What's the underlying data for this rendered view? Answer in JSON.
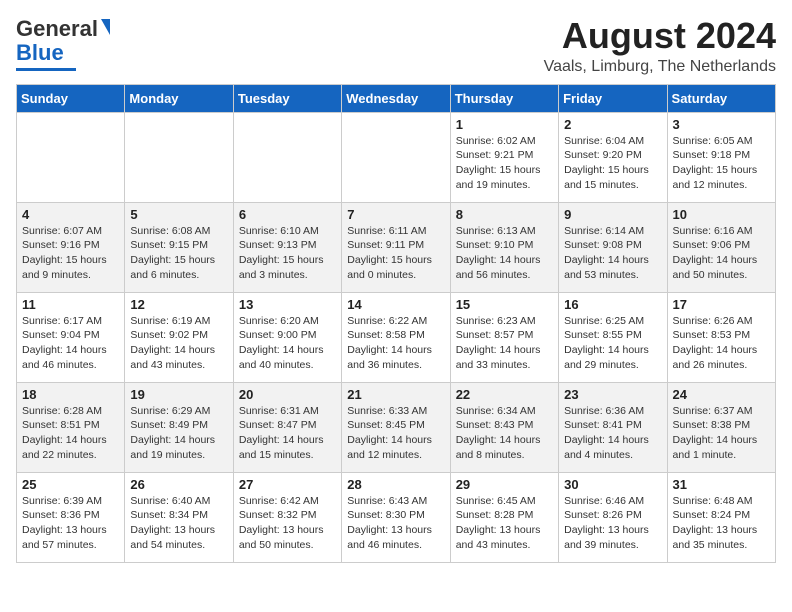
{
  "header": {
    "logo_line1": "General",
    "logo_line2": "Blue",
    "month": "August 2024",
    "location": "Vaals, Limburg, The Netherlands"
  },
  "weekdays": [
    "Sunday",
    "Monday",
    "Tuesday",
    "Wednesday",
    "Thursday",
    "Friday",
    "Saturday"
  ],
  "weeks": [
    [
      {
        "day": "",
        "info": ""
      },
      {
        "day": "",
        "info": ""
      },
      {
        "day": "",
        "info": ""
      },
      {
        "day": "",
        "info": ""
      },
      {
        "day": "1",
        "info": "Sunrise: 6:02 AM\nSunset: 9:21 PM\nDaylight: 15 hours\nand 19 minutes."
      },
      {
        "day": "2",
        "info": "Sunrise: 6:04 AM\nSunset: 9:20 PM\nDaylight: 15 hours\nand 15 minutes."
      },
      {
        "day": "3",
        "info": "Sunrise: 6:05 AM\nSunset: 9:18 PM\nDaylight: 15 hours\nand 12 minutes."
      }
    ],
    [
      {
        "day": "4",
        "info": "Sunrise: 6:07 AM\nSunset: 9:16 PM\nDaylight: 15 hours\nand 9 minutes."
      },
      {
        "day": "5",
        "info": "Sunrise: 6:08 AM\nSunset: 9:15 PM\nDaylight: 15 hours\nand 6 minutes."
      },
      {
        "day": "6",
        "info": "Sunrise: 6:10 AM\nSunset: 9:13 PM\nDaylight: 15 hours\nand 3 minutes."
      },
      {
        "day": "7",
        "info": "Sunrise: 6:11 AM\nSunset: 9:11 PM\nDaylight: 15 hours\nand 0 minutes."
      },
      {
        "day": "8",
        "info": "Sunrise: 6:13 AM\nSunset: 9:10 PM\nDaylight: 14 hours\nand 56 minutes."
      },
      {
        "day": "9",
        "info": "Sunrise: 6:14 AM\nSunset: 9:08 PM\nDaylight: 14 hours\nand 53 minutes."
      },
      {
        "day": "10",
        "info": "Sunrise: 6:16 AM\nSunset: 9:06 PM\nDaylight: 14 hours\nand 50 minutes."
      }
    ],
    [
      {
        "day": "11",
        "info": "Sunrise: 6:17 AM\nSunset: 9:04 PM\nDaylight: 14 hours\nand 46 minutes."
      },
      {
        "day": "12",
        "info": "Sunrise: 6:19 AM\nSunset: 9:02 PM\nDaylight: 14 hours\nand 43 minutes."
      },
      {
        "day": "13",
        "info": "Sunrise: 6:20 AM\nSunset: 9:00 PM\nDaylight: 14 hours\nand 40 minutes."
      },
      {
        "day": "14",
        "info": "Sunrise: 6:22 AM\nSunset: 8:58 PM\nDaylight: 14 hours\nand 36 minutes."
      },
      {
        "day": "15",
        "info": "Sunrise: 6:23 AM\nSunset: 8:57 PM\nDaylight: 14 hours\nand 33 minutes."
      },
      {
        "day": "16",
        "info": "Sunrise: 6:25 AM\nSunset: 8:55 PM\nDaylight: 14 hours\nand 29 minutes."
      },
      {
        "day": "17",
        "info": "Sunrise: 6:26 AM\nSunset: 8:53 PM\nDaylight: 14 hours\nand 26 minutes."
      }
    ],
    [
      {
        "day": "18",
        "info": "Sunrise: 6:28 AM\nSunset: 8:51 PM\nDaylight: 14 hours\nand 22 minutes."
      },
      {
        "day": "19",
        "info": "Sunrise: 6:29 AM\nSunset: 8:49 PM\nDaylight: 14 hours\nand 19 minutes."
      },
      {
        "day": "20",
        "info": "Sunrise: 6:31 AM\nSunset: 8:47 PM\nDaylight: 14 hours\nand 15 minutes."
      },
      {
        "day": "21",
        "info": "Sunrise: 6:33 AM\nSunset: 8:45 PM\nDaylight: 14 hours\nand 12 minutes."
      },
      {
        "day": "22",
        "info": "Sunrise: 6:34 AM\nSunset: 8:43 PM\nDaylight: 14 hours\nand 8 minutes."
      },
      {
        "day": "23",
        "info": "Sunrise: 6:36 AM\nSunset: 8:41 PM\nDaylight: 14 hours\nand 4 minutes."
      },
      {
        "day": "24",
        "info": "Sunrise: 6:37 AM\nSunset: 8:38 PM\nDaylight: 14 hours\nand 1 minute."
      }
    ],
    [
      {
        "day": "25",
        "info": "Sunrise: 6:39 AM\nSunset: 8:36 PM\nDaylight: 13 hours\nand 57 minutes."
      },
      {
        "day": "26",
        "info": "Sunrise: 6:40 AM\nSunset: 8:34 PM\nDaylight: 13 hours\nand 54 minutes."
      },
      {
        "day": "27",
        "info": "Sunrise: 6:42 AM\nSunset: 8:32 PM\nDaylight: 13 hours\nand 50 minutes."
      },
      {
        "day": "28",
        "info": "Sunrise: 6:43 AM\nSunset: 8:30 PM\nDaylight: 13 hours\nand 46 minutes."
      },
      {
        "day": "29",
        "info": "Sunrise: 6:45 AM\nSunset: 8:28 PM\nDaylight: 13 hours\nand 43 minutes."
      },
      {
        "day": "30",
        "info": "Sunrise: 6:46 AM\nSunset: 8:26 PM\nDaylight: 13 hours\nand 39 minutes."
      },
      {
        "day": "31",
        "info": "Sunrise: 6:48 AM\nSunset: 8:24 PM\nDaylight: 13 hours\nand 35 minutes."
      }
    ]
  ]
}
